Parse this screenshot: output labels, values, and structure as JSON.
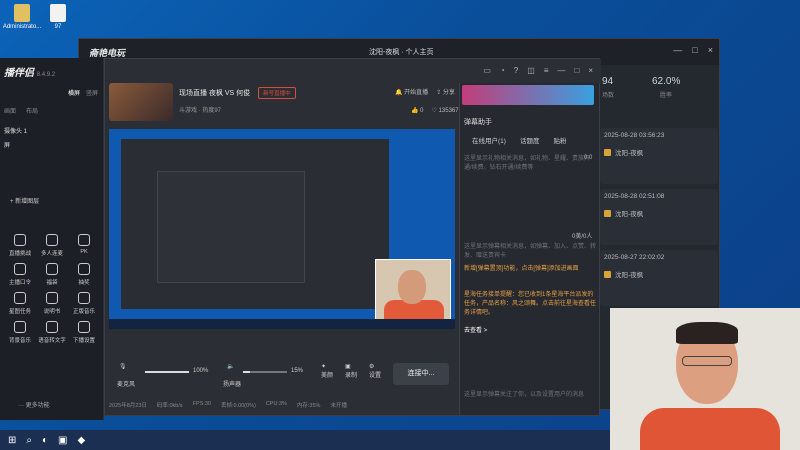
{
  "desktop": {
    "icons": [
      {
        "label": "Administrato..."
      },
      {
        "label": "97"
      }
    ]
  },
  "back_window": {
    "brand": "斋艳电玩",
    "title": "沈阳-夜枫 · 个人主页",
    "stats": {
      "value1": "94",
      "label1": "场数",
      "value2": "62.0%",
      "label2": "胜率"
    },
    "history": [
      {
        "date": "2025-08-28 03:56:23",
        "name": "沈阳-夜枫"
      },
      {
        "date": "2025-08-28 02:51:08",
        "name": "沈阳-夜枫"
      },
      {
        "date": "2025-08-27 22:02:02",
        "name": "沈阳-夜枫"
      }
    ]
  },
  "left_app": {
    "brand": "播伴侣",
    "version": "8.4.9.2",
    "tabs": [
      "横屏",
      "竖屏"
    ],
    "scene_items": [
      "画面",
      "布局"
    ],
    "source_label": "摄像头 1",
    "source_label2": "屏",
    "add_scene": "新增图层",
    "tools": [
      {
        "label": "直播挑战"
      },
      {
        "label": "多人连麦"
      },
      {
        "label": "PK"
      },
      {
        "label": "主播口令"
      },
      {
        "label": "福袋"
      },
      {
        "label": "抽奖"
      },
      {
        "label": "星图任务"
      },
      {
        "label": "说明书"
      },
      {
        "label": "正版音乐"
      },
      {
        "label": "背景音乐"
      },
      {
        "label": "语音转文字"
      },
      {
        "label": "下播设置"
      }
    ],
    "more": "更多功能"
  },
  "main": {
    "live_title": "现场直播 夜枫 VS 何俊",
    "live_badge": "新号直播中",
    "live_sub": "斗游戏 · 热度97",
    "action_start": "开始直播",
    "action_share": "分享",
    "like_count": "0",
    "heart_count": "135367",
    "controls": {
      "mic_label": "麦克风",
      "mic_value": "100%",
      "speaker_label": "扬声器",
      "speaker_value": "15%",
      "beauty_label": "美颜",
      "record_label": "录制",
      "settings_label": "设置",
      "connect_label": "连接中..."
    },
    "footer": [
      "2025年8月23日",
      "码率:0kb/s",
      "FPS:30",
      "丢帧:0.00(0%)",
      "CPU:3%",
      "内存:35%",
      "未开播"
    ]
  },
  "danmu": {
    "title": "弹幕助手",
    "tabs": [
      "在线用户(1)",
      "话题度",
      "贴粉"
    ],
    "count1": "0.0",
    "count2": "0美/0人",
    "msg_gray1": "这里显示礼物相关消息，如礼物、星耀、贵族开通/续费、钻石开通/续费等",
    "msg_gray2": "这里显示弹幕相关消息，如弹幕、加入、点赞、转发、赠送贵宾卡",
    "msg_orange1": "新增[弹幕置顶]功能，点击[弹幕]添加进画面",
    "msg_orange2": "星海任务接单提醒：您已收到1条星海平台派发的任务，产品名称：风之颂舞。点击前往星海查看任务详情吧。",
    "link": "去查看 >",
    "msg_gray3": "这里显示弹幕关注了你，以及设置用户的消息"
  },
  "window_controls": [
    "—",
    "□",
    "×"
  ]
}
